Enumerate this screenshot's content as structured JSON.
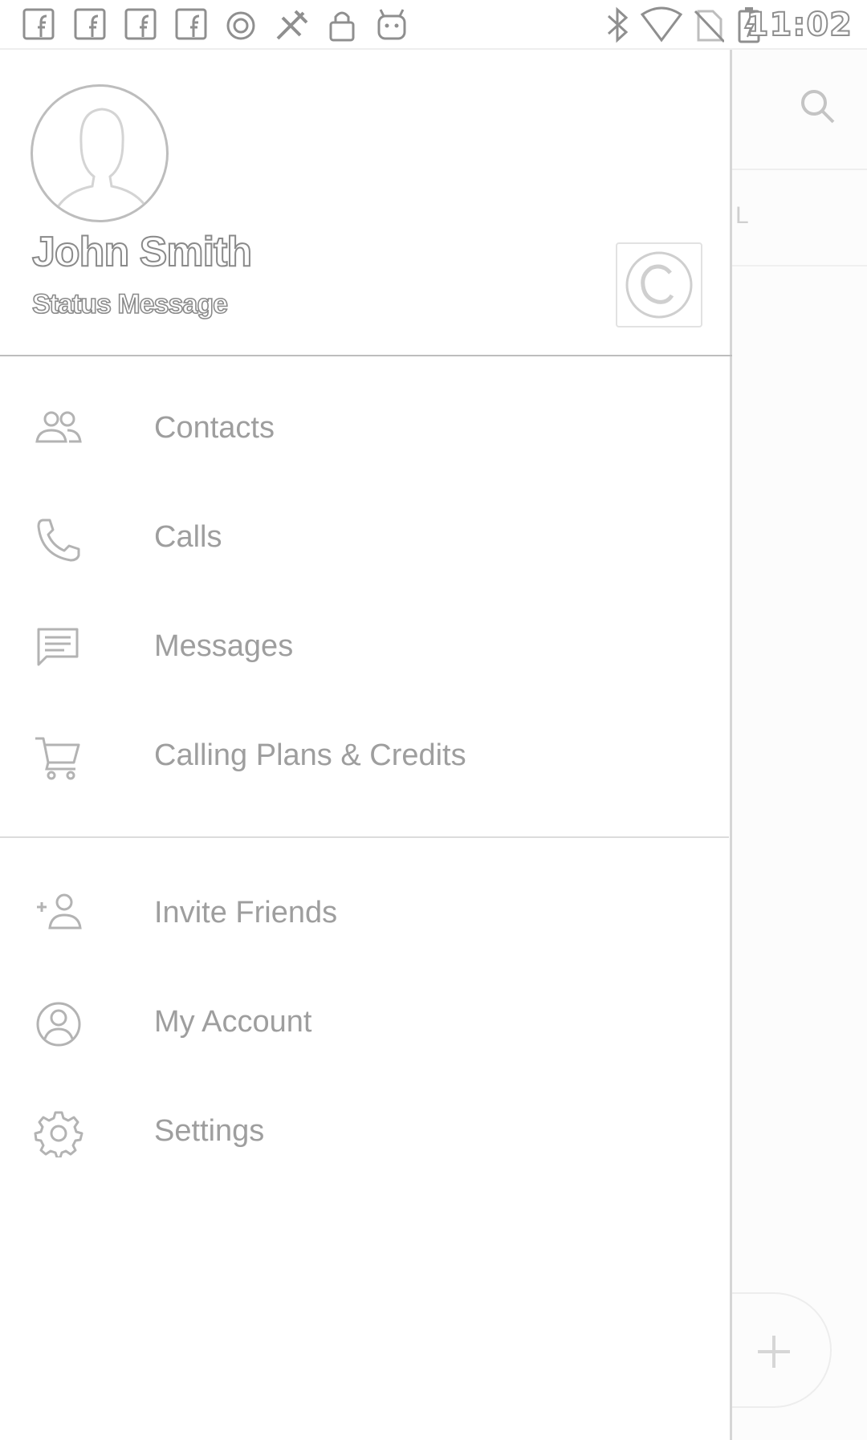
{
  "status_bar": {
    "time": "11:02",
    "icons": [
      "facebook-icon",
      "facebook-icon",
      "facebook-icon",
      "facebook-icon",
      "circle-notification-icon",
      "tool-icon",
      "lock-icon",
      "android-icon",
      "bluetooth-icon",
      "wifi-icon",
      "no-sim-icon",
      "battery-charging-icon"
    ]
  },
  "drawer": {
    "profile": {
      "name": "John Smith",
      "status": "Status Message"
    },
    "menu_primary": [
      {
        "label": "Contacts",
        "icon": "contacts-icon"
      },
      {
        "label": "Calls",
        "icon": "phone-icon"
      },
      {
        "label": "Messages",
        "icon": "message-icon"
      },
      {
        "label": "Calling Plans & Credits",
        "icon": "cart-icon"
      }
    ],
    "menu_secondary": [
      {
        "label": "Invite Friends",
        "icon": "add-person-icon"
      },
      {
        "label": "My Account",
        "icon": "account-icon"
      },
      {
        "label": "Settings",
        "icon": "gear-icon"
      }
    ]
  },
  "background_app": {
    "section_letter": "L"
  },
  "colors": {
    "icon_stroke": "#b3b3b3",
    "label_text": "#9e9e9e",
    "divider": "#dcdcdc"
  }
}
